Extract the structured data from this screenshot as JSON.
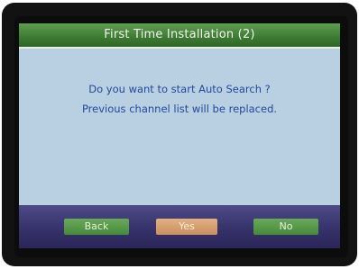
{
  "dialog": {
    "title": "First Time Installation (2)",
    "message_line1": "Do you want to start Auto Search ?",
    "message_line2": "Previous channel list will be replaced."
  },
  "buttons": {
    "back": "Back",
    "yes": "Yes",
    "no": "No",
    "selected": "Yes"
  },
  "colors": {
    "title_bar": "#3d7a33",
    "dialog_background": "#b8d0e2",
    "message_text": "#24489a",
    "button_bar": "#36326a",
    "button_normal": "#468a3b",
    "button_selected": "#c98f5e"
  }
}
